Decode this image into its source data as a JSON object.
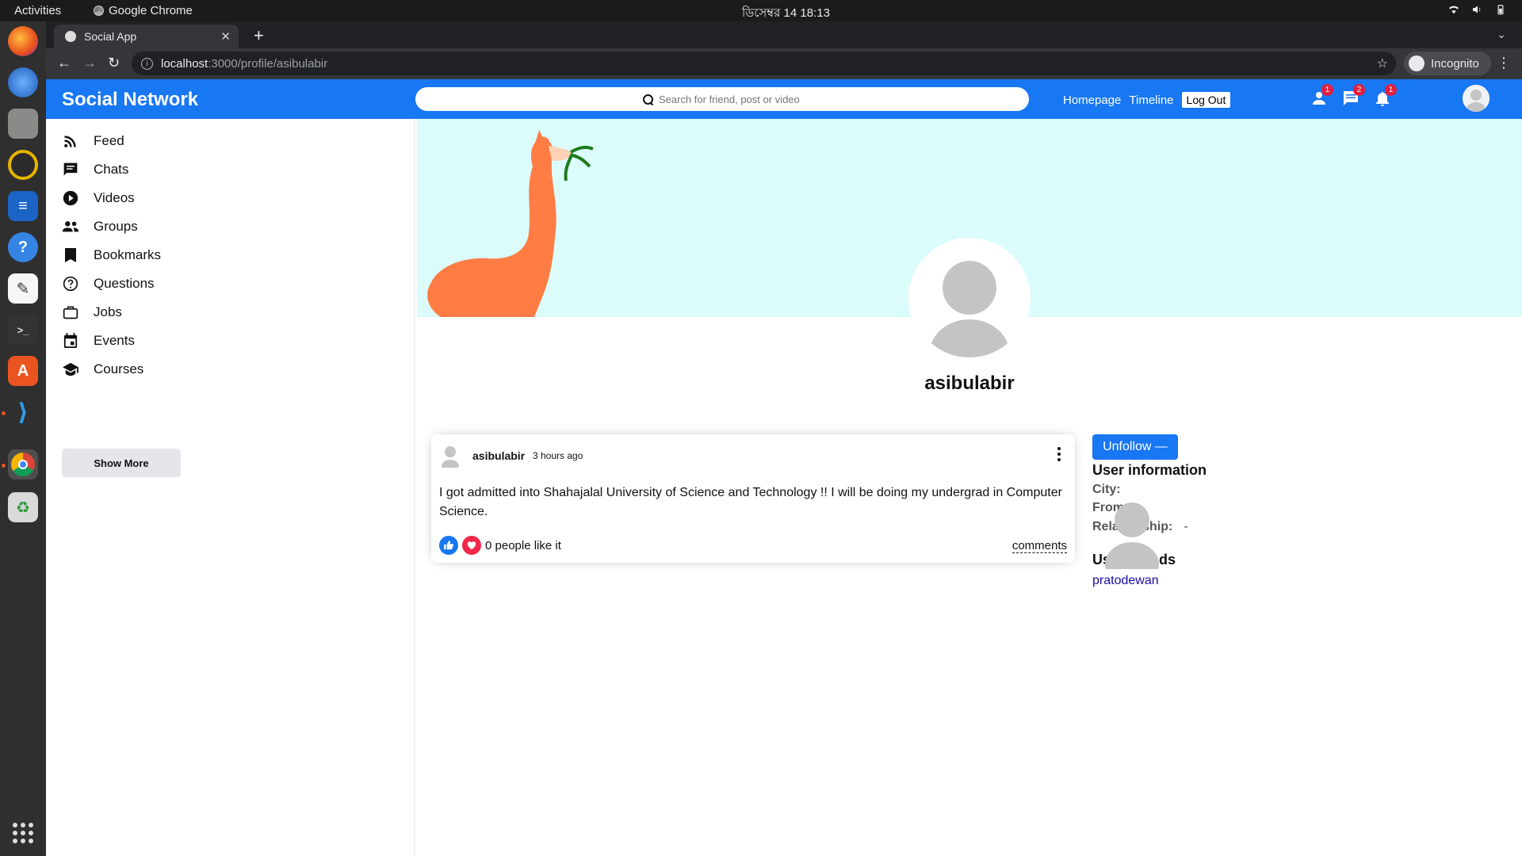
{
  "os": {
    "activities": "Activities",
    "app_name": "Google Chrome",
    "clock": "ডিসেম্বর 14  18:13"
  },
  "browser": {
    "tab_title": "Social App",
    "url_host": "localhost",
    "url_path": ":3000/profile/asibulabir",
    "incognito_label": "Incognito"
  },
  "app": {
    "brand": "Social Network",
    "search_placeholder": "Search for friend, post or video",
    "links": {
      "homepage": "Homepage",
      "timeline": "Timeline",
      "logout": "Log Out"
    },
    "badges": {
      "friends": "1",
      "messages": "2",
      "notifications": "1"
    }
  },
  "sidebar": {
    "items": [
      {
        "label": "Feed",
        "icon": "rss-feed-icon"
      },
      {
        "label": "Chats",
        "icon": "chat-icon"
      },
      {
        "label": "Videos",
        "icon": "play-circle-icon"
      },
      {
        "label": "Groups",
        "icon": "group-icon"
      },
      {
        "label": "Bookmarks",
        "icon": "bookmark-icon"
      },
      {
        "label": "Questions",
        "icon": "help-circle-icon"
      },
      {
        "label": "Jobs",
        "icon": "briefcase-icon"
      },
      {
        "label": "Events",
        "icon": "calendar-icon"
      },
      {
        "label": "Courses",
        "icon": "school-icon"
      }
    ],
    "show_more": "Show More"
  },
  "profile": {
    "username": "asibulabir",
    "cover_color": "#dcfcfc"
  },
  "post": {
    "user": "asibulabir",
    "time": "3 hours ago",
    "text": "I got admitted into Shahajalal University of Science and Technology !! I will be doing my undergrad in Computer Science.",
    "likes": "0 people like it",
    "comments": "comments"
  },
  "rightbar": {
    "unfollow": "Unfollow —",
    "info_title": "User information",
    "info": [
      {
        "key": "City:",
        "value": ""
      },
      {
        "key": "From:",
        "value": ""
      },
      {
        "key": "Relationship:",
        "value": "-"
      }
    ],
    "friends_title": "User friends",
    "friends": [
      {
        "name": "pratodewan"
      }
    ]
  },
  "colors": {
    "primary": "#1877f2",
    "badge": "#e41e3f"
  }
}
